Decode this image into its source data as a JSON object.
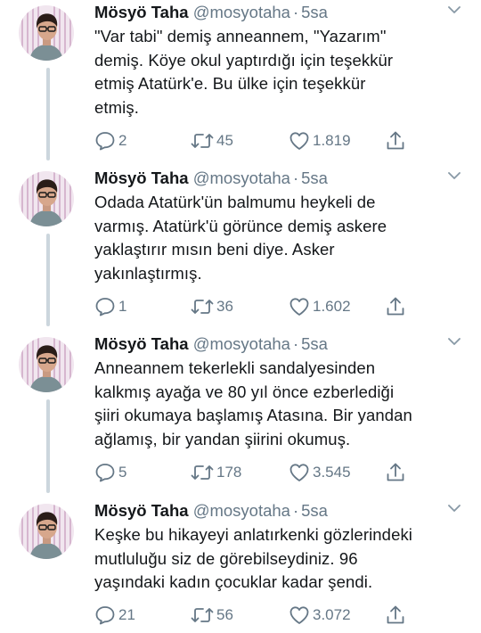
{
  "tweets": [
    {
      "name": "Mösyö Taha",
      "handle": "@mosyotaha",
      "separator": "·",
      "time": "5sa",
      "lines": [
        "\"Var tabi\" demiş anneannem, \"Yazarım\"",
        "demiş. Köye okul yaptırdığı için teşekkür",
        "etmiş Atatürk'e. Bu ülke için teşekkür",
        "etmiş."
      ],
      "replies": "2",
      "retweets": "45",
      "likes": "1.819"
    },
    {
      "name": "Mösyö Taha",
      "handle": "@mosyotaha",
      "separator": "·",
      "time": "5sa",
      "lines": [
        "Odada Atatürk'ün balmumu heykeli de",
        "varmış. Atatürk'ü görünce demiş askere",
        "yaklaştırır mısın beni diye. Asker",
        "yakınlaştırmış."
      ],
      "replies": "1",
      "retweets": "36",
      "likes": "1.602"
    },
    {
      "name": "Mösyö Taha",
      "handle": "@mosyotaha",
      "separator": "·",
      "time": "5sa",
      "lines": [
        "Anneannem tekerlekli sandalyesinden",
        "kalkmış ayağa ve 80 yıl önce ezberlediği",
        "şiiri okumaya başlamış Atasına. Bir yandan",
        "ağlamış, bir yandan şiirini okumuş."
      ],
      "replies": "5",
      "retweets": "178",
      "likes": "3.545"
    },
    {
      "name": "Mösyö Taha",
      "handle": "@mosyotaha",
      "separator": "·",
      "time": "5sa",
      "lines": [
        "Keşke bu hikayeyi anlatırkenki gözlerindeki",
        "mutluluğu siz de görebilseydiniz. 96",
        "yaşındaki kadın çocuklar kadar şendi."
      ],
      "replies": "21",
      "retweets": "56",
      "likes": "3.072"
    }
  ],
  "icons": {
    "reply": "reply-icon",
    "retweet": "retweet-icon",
    "like": "heart-icon",
    "share": "share-icon",
    "caret": "chevron-down-icon",
    "avatar": "avatar"
  },
  "colors": {
    "text": "#14171a",
    "muted": "#657786",
    "thread_line": "#ccd6dd",
    "background": "#ffffff"
  }
}
